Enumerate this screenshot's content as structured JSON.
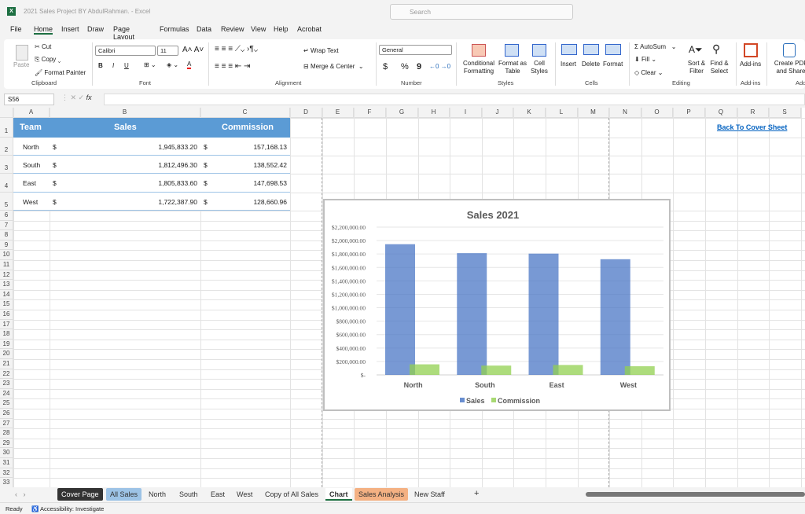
{
  "window": {
    "title": "2021 Sales Project BY AbdulRahman.  -  Excel",
    "search_placeholder": "Search"
  },
  "menu": [
    "File",
    "Home",
    "Insert",
    "Draw",
    "Page Layout",
    "Formulas",
    "Data",
    "Review",
    "View",
    "Help",
    "Acrobat"
  ],
  "ribbon": {
    "paste": "Paste",
    "cut": "Cut",
    "copy": "Copy",
    "format_painter": "Format Painter",
    "clipboard": "Clipboard",
    "font_name": "Calibri",
    "font_size": "11",
    "bold": "B",
    "italic": "I",
    "underline": "U",
    "font": "Font",
    "wrap_text": "Wrap Text",
    "merge_center": "Merge & Center",
    "alignment": "Alignment",
    "number_format": "General",
    "currency": "$",
    "percent": "%",
    "comma": "9",
    "number": "Number",
    "conditional": "Conditional Formatting",
    "format_table": "Format as Table",
    "cell_styles": "Cell Styles",
    "styles": "Styles",
    "insert": "Insert",
    "delete": "Delete",
    "format": "Format",
    "cells": "Cells",
    "autosum": "AutoSum",
    "fill": "Fill",
    "clear": "Clear",
    "sort_filter": "Sort & Filter",
    "find_select": "Find & Select",
    "editing": "Editing",
    "addins": "Add-ins",
    "addins_group": "Add-ins",
    "create_pdf": "Create PDF and Share link",
    "adobe_group": "Ado"
  },
  "formula_bar": {
    "name_box": "S56",
    "fx": "fx",
    "formula": ""
  },
  "columns": [
    "A",
    "B",
    "C",
    "D",
    "E",
    "F",
    "G",
    "H",
    "I",
    "J",
    "K",
    "L",
    "M",
    "N",
    "O",
    "P",
    "Q",
    "R",
    "S"
  ],
  "table": {
    "headers": [
      "Team",
      "Sales",
      "Commission"
    ],
    "rows": [
      [
        "North",
        "$",
        "1,945,833.20",
        "$",
        "157,168.13"
      ],
      [
        "South",
        "$",
        "1,812,496.30",
        "$",
        "138,552.42"
      ],
      [
        "East",
        "$",
        "1,805,833.60",
        "$",
        "147,698.53"
      ],
      [
        "West",
        "$",
        "1,722,387.90",
        "$",
        "128,660.96"
      ]
    ]
  },
  "link": "Back To Cover Sheet",
  "chart_data": {
    "type": "bar",
    "title": "Sales 2021",
    "categories": [
      "North",
      "South",
      "East",
      "West"
    ],
    "series": [
      {
        "name": "Sales",
        "color": "#4472c4",
        "values": [
          1945833.2,
          1812496.3,
          1805833.6,
          1722387.9
        ]
      },
      {
        "name": "Commission",
        "color": "#92d050",
        "values": [
          157168.13,
          138552.42,
          147698.53,
          128660.96
        ]
      }
    ],
    "ylim": [
      0,
      2200000
    ],
    "yticks": [
      "$-",
      "$200,000.00",
      "$400,000.00",
      "$600,000.00",
      "$800,000.00",
      "$1,000,000.00",
      "$1,200,000.00",
      "$1,400,000.00",
      "$1,600,000.00",
      "$1,800,000.00",
      "$2,000,000.00",
      "$2,200,000.00"
    ],
    "grid": true,
    "legend": "bottom"
  },
  "tabs": [
    {
      "label": "Cover Page",
      "bg": "#333333",
      "fg": "#ffffff"
    },
    {
      "label": "All Sales",
      "bg": "#9dc3e6",
      "fg": "#333333"
    },
    {
      "label": "North"
    },
    {
      "label": "South"
    },
    {
      "label": "East"
    },
    {
      "label": "West"
    },
    {
      "label": "Copy of All Sales"
    },
    {
      "label": "Chart",
      "active": true
    },
    {
      "label": "Sales Analysis",
      "bg": "#f4b183",
      "fg": "#333333"
    },
    {
      "label": "New Staff"
    }
  ],
  "add_sheet": "+",
  "status": {
    "ready": "Ready",
    "accessibility": "Accessibility: Investigate"
  }
}
